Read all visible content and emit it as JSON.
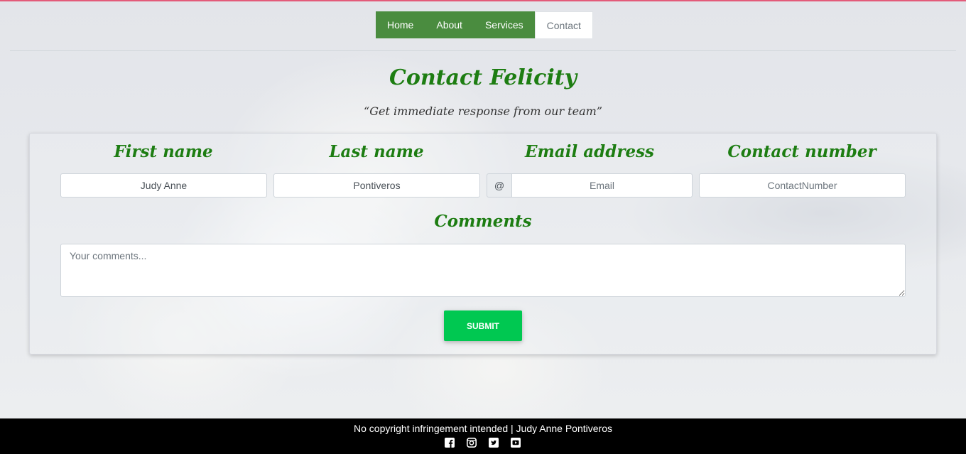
{
  "nav": {
    "items": [
      {
        "label": "Home",
        "active": false
      },
      {
        "label": "About",
        "active": false
      },
      {
        "label": "Services",
        "active": false
      },
      {
        "label": "Contact",
        "active": true
      }
    ]
  },
  "header": {
    "title": "Contact Felicity",
    "subtitle": "“Get immediate response from our team”"
  },
  "form": {
    "first_name": {
      "label": "First name",
      "value": "Judy Anne"
    },
    "last_name": {
      "label": "Last name",
      "value": "Pontiveros"
    },
    "email": {
      "label": "Email address",
      "addon": "@",
      "placeholder": "Email",
      "value": ""
    },
    "contact": {
      "label": "Contact number",
      "placeholder": "ContactNumber",
      "value": ""
    },
    "comments": {
      "label": "Comments",
      "placeholder": "Your comments..."
    },
    "submit_label": "SUBMIT"
  },
  "footer": {
    "text": "No copyright infringement intended | Judy Anne Pontiveros",
    "social_icons": [
      "facebook-icon",
      "instagram-icon",
      "twitter-icon",
      "youtube-icon"
    ]
  },
  "colors": {
    "nav_green": "#4a8c3f",
    "heading_green": "#1d7d12",
    "submit_green": "#00c851",
    "footer_bg": "#000000"
  }
}
